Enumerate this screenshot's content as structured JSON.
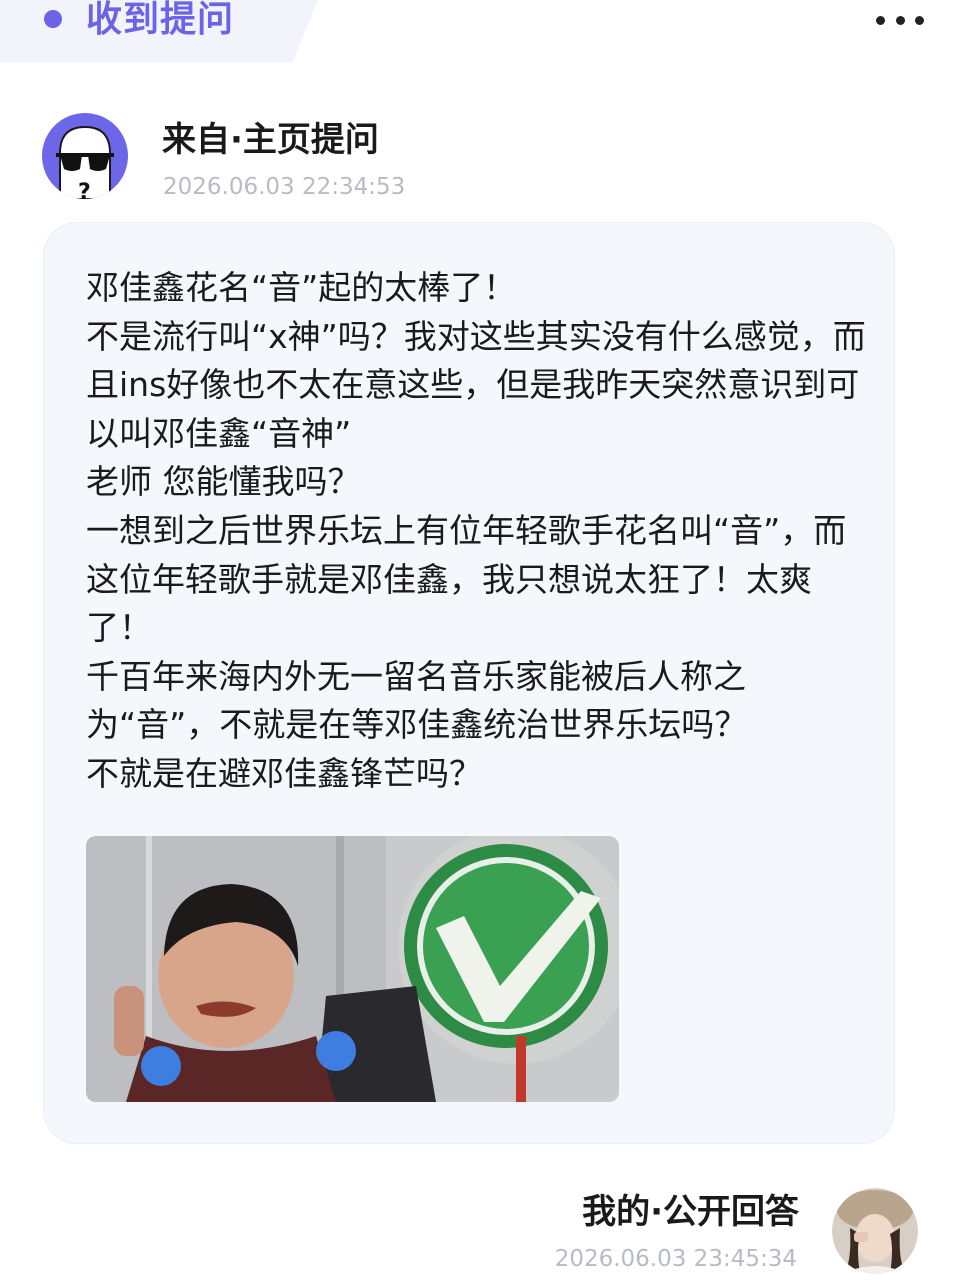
{
  "header": {
    "title": "收到提问",
    "accent_color": "#6b64e8",
    "more_icon": "more-dots-icon"
  },
  "asker": {
    "avatar_icon": "anonymous-sunglasses-avatar",
    "name": "来自·主页提问",
    "time": "2026.06.03 22:34:53"
  },
  "question": {
    "text": "邓佳鑫花名“音”起的太棒了！\n不是流行叫“x神”吗？我对这些其实没有什么感觉，而且ins好像也不太在意这些，但是我昨天突然意识到可以叫邓佳鑫“音神”\n老师 您能懂我吗？\n一想到之后世界乐坛上有位年轻歌手花名叫“音”，而这位年轻歌手就是邓佳鑫，我只想说太狂了！太爽了！\n千百年来海内外无一留名音乐家能被后人称之为“音”，不就是在等邓佳鑫统治世界乐坛吗？\n不就是在避邓佳鑫锋芒吗？",
    "image_icon": "meme-photo-with-check-icon"
  },
  "answer": {
    "label": "我的·公开回答",
    "time": "2026.06.03 23:45:34",
    "avatar_icon": "user-photo-avatar"
  }
}
